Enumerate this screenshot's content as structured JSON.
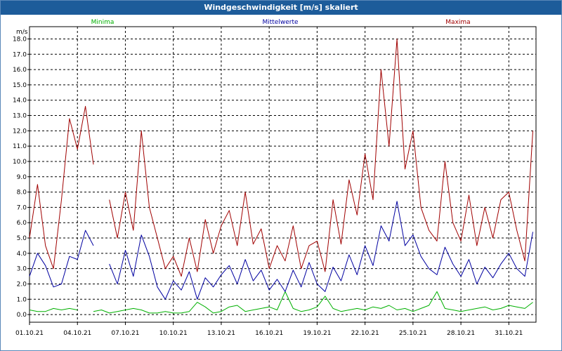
{
  "window": {
    "title": "Windgeschwindigkeit [m/s] skaliert"
  },
  "chart_data": {
    "type": "line",
    "title": "Windgeschwindigkeit [m/s] skaliert",
    "ylabel": "m/s",
    "xlabel": "",
    "ylim": [
      -0.5,
      18.8
    ],
    "yticks": [
      0.0,
      1.0,
      2.0,
      3.0,
      4.0,
      5.0,
      6.0,
      7.0,
      8.0,
      9.0,
      10.0,
      11.0,
      12.0,
      13.0,
      14.0,
      15.0,
      16.0,
      17.0,
      18.0
    ],
    "xlim": [
      0,
      31.7
    ],
    "xticks": [
      {
        "label": "01.10.21",
        "x": 0
      },
      {
        "label": "04.10.21",
        "x": 3
      },
      {
        "label": "07.10.21",
        "x": 6
      },
      {
        "label": "10.10.21",
        "x": 9
      },
      {
        "label": "13.10.21",
        "x": 12
      },
      {
        "label": "16.10.21",
        "x": 15
      },
      {
        "label": "19.10.21",
        "x": 18
      },
      {
        "label": "22.10.21",
        "x": 21
      },
      {
        "label": "25.10.21",
        "x": 24
      },
      {
        "label": "28.10.21",
        "x": 27
      },
      {
        "label": "31.10.21",
        "x": 30
      }
    ],
    "grid": true,
    "legend_placement": "top",
    "series": [
      {
        "name": "Minima",
        "color": "#00b000",
        "x": [
          0,
          0.5,
          1,
          1.5,
          2,
          2.5,
          3,
          3.5,
          4,
          4.5,
          5,
          5.5,
          6,
          6.5,
          7,
          7.5,
          8,
          8.5,
          9,
          9.5,
          10,
          10.5,
          11,
          11.5,
          12,
          12.5,
          13,
          13.5,
          14,
          14.5,
          15,
          15.5,
          16,
          16.5,
          17,
          17.5,
          18,
          18.5,
          19,
          19.5,
          20,
          20.5,
          21,
          21.5,
          22,
          22.5,
          23,
          23.5,
          24,
          24.5,
          25,
          25.5,
          26,
          26.5,
          27,
          27.5,
          28,
          28.5,
          29,
          29.5,
          30,
          30.5,
          31,
          31.5
        ],
        "y": [
          0.3,
          0.2,
          0.2,
          0.4,
          0.3,
          0.4,
          0.3,
          null,
          0.2,
          0.3,
          0.1,
          0.2,
          0.3,
          0.4,
          0.3,
          0.1,
          0.1,
          0.2,
          0.1,
          0.1,
          0.2,
          0.8,
          0.5,
          0.1,
          0.2,
          0.5,
          0.6,
          0.2,
          0.3,
          0.4,
          0.5,
          0.3,
          1.5,
          0.4,
          0.2,
          0.3,
          0.5,
          1.2,
          0.4,
          0.2,
          0.3,
          0.4,
          0.3,
          0.5,
          0.4,
          0.6,
          0.3,
          0.4,
          0.2,
          0.4,
          0.6,
          1.5,
          0.4,
          0.3,
          0.2,
          0.3,
          0.4,
          0.5,
          0.3,
          0.4,
          0.6,
          0.5,
          0.4,
          0.8
        ]
      },
      {
        "name": "Mittelwerte",
        "color": "#0000a0",
        "x": [
          0,
          0.5,
          1,
          1.5,
          2,
          2.5,
          3,
          3.5,
          4,
          4.5,
          5,
          5.5,
          6,
          6.5,
          7,
          7.5,
          8,
          8.5,
          9,
          9.5,
          10,
          10.5,
          11,
          11.5,
          12,
          12.5,
          13,
          13.5,
          14,
          14.5,
          15,
          15.5,
          16,
          16.5,
          17,
          17.5,
          18,
          18.5,
          19,
          19.5,
          20,
          20.5,
          21,
          21.5,
          22,
          22.5,
          23,
          23.5,
          24,
          24.5,
          25,
          25.5,
          26,
          26.5,
          27,
          27.5,
          28,
          28.5,
          29,
          29.5,
          30,
          30.5,
          31,
          31.5
        ],
        "y": [
          2.5,
          4.0,
          3.2,
          1.8,
          2.0,
          3.8,
          3.6,
          5.5,
          4.5,
          null,
          3.3,
          2.0,
          4.2,
          2.5,
          5.2,
          3.8,
          1.8,
          1.0,
          2.2,
          1.6,
          2.8,
          1.0,
          2.4,
          1.8,
          2.6,
          3.2,
          2.0,
          3.6,
          2.2,
          2.9,
          1.6,
          2.3,
          1.5,
          2.9,
          1.8,
          3.4,
          2.0,
          1.5,
          3.1,
          2.2,
          3.9,
          2.6,
          4.5,
          3.2,
          5.8,
          4.8,
          7.4,
          4.5,
          5.2,
          3.8,
          3.0,
          2.6,
          4.4,
          3.3,
          2.5,
          3.6,
          2.0,
          3.1,
          2.4,
          3.3,
          4.0,
          3.0,
          2.5,
          5.4
        ]
      },
      {
        "name": "Maxima",
        "color": "#a00000",
        "x": [
          0,
          0.5,
          1,
          1.5,
          2,
          2.5,
          3,
          3.5,
          4,
          4.5,
          5,
          5.5,
          6,
          6.5,
          7,
          7.5,
          8,
          8.5,
          9,
          9.5,
          10,
          10.5,
          11,
          11.5,
          12,
          12.5,
          13,
          13.5,
          14,
          14.5,
          15,
          15.5,
          16,
          16.5,
          17,
          17.5,
          18,
          18.5,
          19,
          19.5,
          20,
          20.5,
          21,
          21.5,
          22,
          22.5,
          23,
          23.5,
          24,
          24.5,
          25,
          25.5,
          26,
          26.5,
          27,
          27.5,
          28,
          28.5,
          29,
          29.5,
          30,
          30.5,
          31,
          31.5
        ],
        "y": [
          5.0,
          8.5,
          4.5,
          3.0,
          7.5,
          12.8,
          10.8,
          13.6,
          9.8,
          null,
          7.5,
          5.0,
          8.0,
          5.5,
          12.0,
          7.0,
          5.0,
          3.0,
          3.8,
          2.5,
          5.0,
          2.8,
          6.2,
          4.0,
          5.8,
          6.8,
          4.5,
          8.0,
          4.6,
          5.6,
          3.0,
          4.5,
          3.5,
          5.8,
          3.0,
          4.5,
          4.8,
          2.8,
          7.5,
          4.6,
          8.8,
          6.5,
          10.5,
          7.5,
          16.0,
          11.0,
          18.0,
          9.5,
          12.0,
          7.0,
          5.5,
          4.8,
          10.0,
          6.0,
          4.8,
          7.8,
          4.5,
          7.0,
          5.0,
          7.5,
          8.0,
          5.5,
          3.5,
          12.0
        ]
      }
    ]
  }
}
